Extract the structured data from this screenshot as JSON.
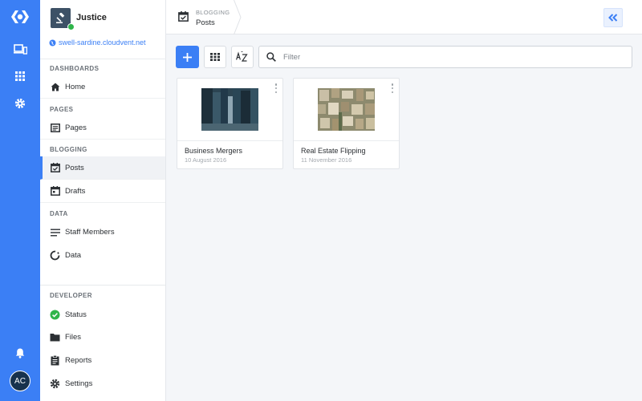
{
  "site": {
    "name": "Justice",
    "url": "swell-sardine.cloudvent.net"
  },
  "sidebar": {
    "sections": [
      {
        "label": "DASHBOARDS",
        "items": [
          {
            "label": "Home",
            "icon": "home-icon"
          }
        ]
      },
      {
        "label": "PAGES",
        "items": [
          {
            "label": "Pages",
            "icon": "pages-icon"
          }
        ]
      },
      {
        "label": "BLOGGING",
        "items": [
          {
            "label": "Posts",
            "icon": "calendar-check-icon",
            "active": true
          },
          {
            "label": "Drafts",
            "icon": "calendar-icon"
          }
        ]
      },
      {
        "label": "DATA",
        "items": [
          {
            "label": "Staff Members",
            "icon": "list-icon"
          },
          {
            "label": "Data",
            "icon": "ring-icon"
          }
        ]
      },
      {
        "label": "DEVELOPER",
        "items": [
          {
            "label": "Status",
            "icon": "status-check-icon"
          },
          {
            "label": "Files",
            "icon": "folder-icon"
          },
          {
            "label": "Reports",
            "icon": "clipboard-icon"
          },
          {
            "label": "Settings",
            "icon": "gear-icon"
          }
        ]
      }
    ]
  },
  "rail": {
    "avatar_initials": "AC"
  },
  "header": {
    "breadcrumb_section": "BLOGGING",
    "breadcrumb_page": "Posts"
  },
  "toolbar": {
    "filter_placeholder": "Filter"
  },
  "posts": [
    {
      "title": "Business Mergers",
      "date": "10 August 2016"
    },
    {
      "title": "Real Estate Flipping",
      "date": "11 November 2016"
    }
  ],
  "colors": {
    "accent": "#3b7ff5",
    "status_ok": "#2fb54a",
    "rail": "#3b7ff5"
  }
}
